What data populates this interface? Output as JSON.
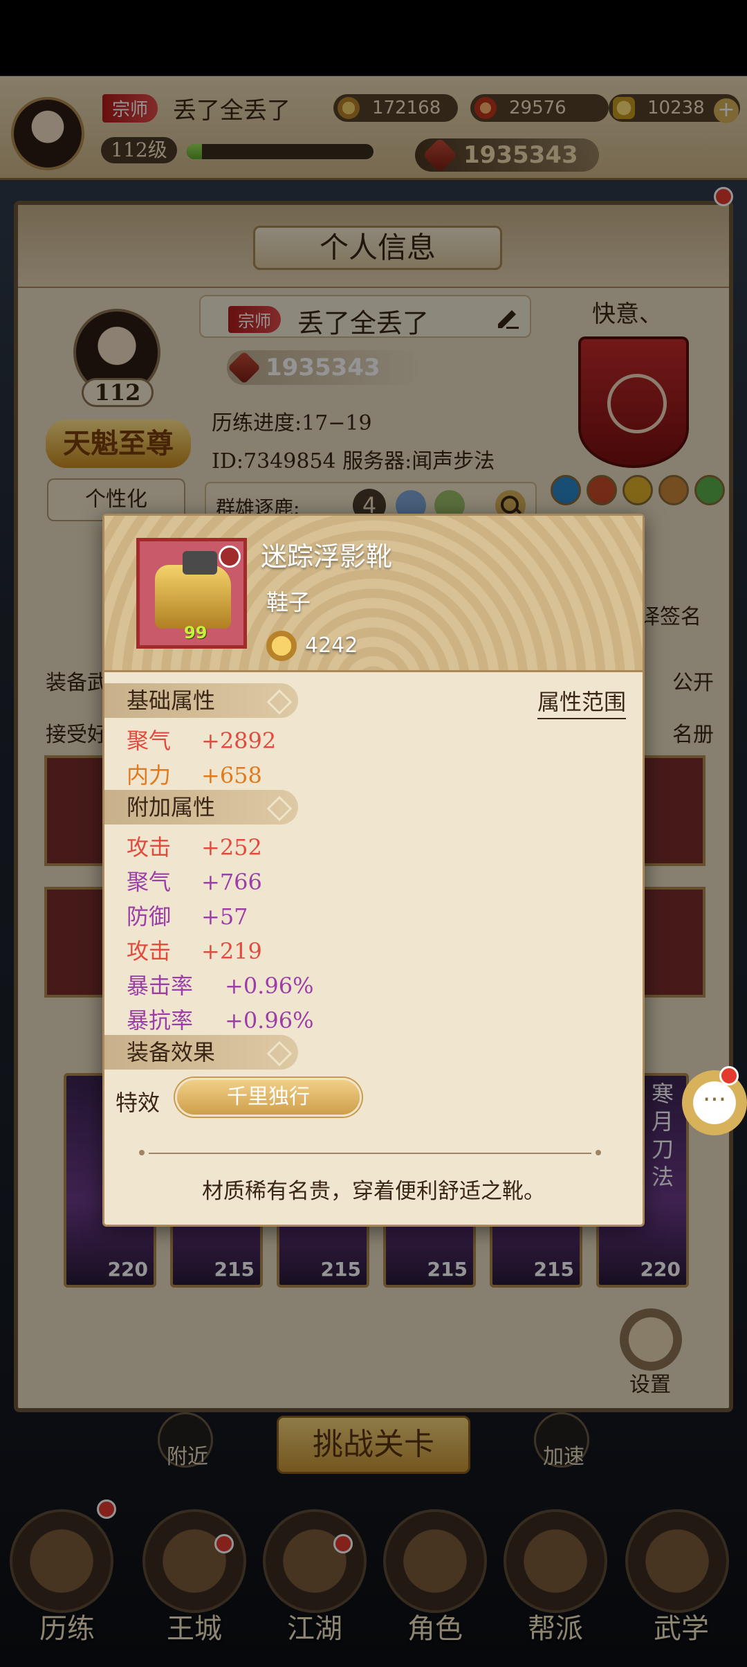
{
  "hud": {
    "rank": "宗师",
    "player_name": "丢了全丢了",
    "coins": "172168",
    "fire": "29576",
    "gold": "10238",
    "level": "112级",
    "exp_fraction": 0.08,
    "power": "1935343"
  },
  "panel": {
    "title": "个人信息",
    "avatar_level": "112",
    "emblem": "天魁至尊",
    "customize_label": "个性化",
    "rank": "宗师",
    "name": "丢了全丢了",
    "power": "1935343",
    "progress": "历练进度:17−19",
    "id_server": "ID:7349854  服务器:闻声步法",
    "search_label": "群雄逐鹿:",
    "search_count": "4",
    "guild_name": "快意、",
    "side_left_1": "装备武",
    "side_left_2": "接受好",
    "side_right_1": "公开",
    "side_right_2": "名册",
    "side_right_top": "译签名",
    "hero_levels": [
      "220",
      "215",
      "215",
      "215",
      "215",
      "220"
    ],
    "hero_title": "寒月刀法",
    "settings_label": "设置"
  },
  "popup": {
    "item_name": "迷踪浮影靴",
    "item_type": "鞋子",
    "item_level": "99",
    "item_power": "4242",
    "base_title": "基础属性",
    "range_label": "属性范围",
    "base_attrs": [
      {
        "name": "聚气",
        "value": "+2892"
      },
      {
        "name": "内力",
        "value": "+658"
      }
    ],
    "extra_title": "附加属性",
    "extra_attrs": [
      {
        "name": "攻击",
        "value": "+252"
      },
      {
        "name": "聚气",
        "value": "+766"
      },
      {
        "name": "防御",
        "value": "+57"
      },
      {
        "name": "攻击",
        "value": "+219"
      },
      {
        "name": "暴击率",
        "value": "+0.96%"
      },
      {
        "name": "暴抗率",
        "value": "+0.96%"
      }
    ],
    "effect_title": "装备效果",
    "effect_label": "特效",
    "effect_name": "千里独行",
    "description": "材质稀有名贵，穿着便利舒适之靴。"
  },
  "bottom": {
    "challenge": "挑战关卡",
    "nearby": "附近",
    "speedup": "加速",
    "nav": [
      "历练",
      "王城",
      "江湖",
      "角色",
      "帮派",
      "武学"
    ]
  },
  "colors": {
    "red_attr": "#e34a3e",
    "orange_attr": "#e07a1e",
    "purple_attr": "#9c3ea8"
  }
}
